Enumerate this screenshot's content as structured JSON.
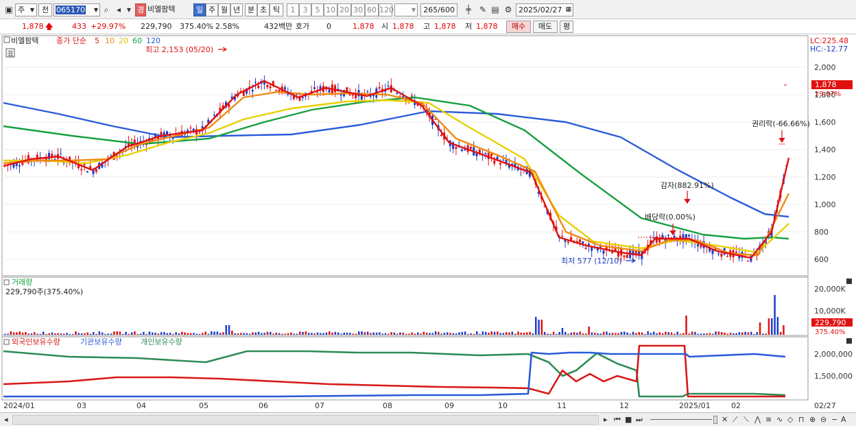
{
  "toolbar": {
    "market_select": "주",
    "prev_label": "전",
    "code_value": "065170",
    "stock_tag": "경",
    "stock_name": "비엘팜텍",
    "periods": [
      "일",
      "주",
      "월",
      "년",
      "분",
      "초",
      "틱"
    ],
    "active_period": "일",
    "intervals": [
      "1",
      "3",
      "5",
      "10",
      "20",
      "30",
      "60",
      "120"
    ],
    "count": "265",
    "count_max": "/600",
    "date": "2025/02/27"
  },
  "quote": {
    "price": "1,878",
    "change": "433",
    "change_pct": "+29.97%",
    "volume": "229,790",
    "volume_ratio": "375.40%",
    "turnover_pct": "2.58%",
    "trade_value": "432백만",
    "hoga_label": "호가",
    "hoga_value": "0",
    "last": "1,878",
    "open_label": "시",
    "open": "1,878",
    "high_label": "고",
    "high": "1,878",
    "low_label": "저",
    "low": "1,878",
    "buy_label": "매수",
    "sell_label": "매도",
    "avg_label": "평"
  },
  "price_panel": {
    "name": "비엘팜텍",
    "ma_title": "종가 단순",
    "ma_periods": [
      "5",
      "10",
      "20",
      "60",
      "120"
    ],
    "ma_colors": [
      "#e01010",
      "#f08a10",
      "#e8d000",
      "#17a040",
      "#2a5bd8"
    ],
    "lc": "LC:225.48",
    "hc": "HC:-12.77",
    "current_tag": "1,878",
    "current_pct": "29.97%",
    "high_note": "최고 2,153 (05/20)",
    "low_note": "최저 577 (12/10)",
    "event_gamja": "감자(882.91%)",
    "event_dividend": "배당락(0.00%)",
    "event_rights": "권리락(-66.66%)",
    "y_ticks": [
      "2,000",
      "1,800",
      "1,600",
      "1,400",
      "1,200",
      "1,000",
      "800",
      "600"
    ]
  },
  "volume_panel": {
    "title": "거래량",
    "info": "229,790주(375.40%)",
    "y_ticks": [
      "20,000K",
      "10,000K"
    ],
    "current_tag": "229,790",
    "current_pct": "375.40%"
  },
  "holdings_panel": {
    "legend": [
      "외국인보유수량",
      "기관보유수량",
      "개인보유수량"
    ],
    "legend_colors": [
      "#d81818",
      "#2a5bd8",
      "#2e8b57"
    ],
    "y_ticks": [
      "2,000,000",
      "1,500,000"
    ]
  },
  "x_axis": {
    "labels": [
      "2024/01",
      "03",
      "04",
      "05",
      "06",
      "07",
      "08",
      "09",
      "10",
      "11",
      "12",
      "2025/01",
      "02"
    ],
    "end_label": "02/27"
  },
  "chart_data": {
    "type": "candlestick-with-indicators",
    "ma_series": [
      {
        "name": "5",
        "points": [
          [
            0,
            1280
          ],
          [
            40,
            1330
          ],
          [
            80,
            1350
          ],
          [
            130,
            1250
          ],
          [
            180,
            1420
          ],
          [
            230,
            1500
          ],
          [
            290,
            1540
          ],
          [
            340,
            1800
          ],
          [
            380,
            1900
          ],
          [
            430,
            1780
          ],
          [
            470,
            1850
          ],
          [
            530,
            1790
          ],
          [
            565,
            1850
          ],
          [
            610,
            1720
          ],
          [
            650,
            1450
          ],
          [
            700,
            1360
          ],
          [
            770,
            1230
          ],
          [
            810,
            760
          ],
          [
            850,
            700
          ],
          [
            900,
            650
          ],
          [
            930,
            630
          ],
          [
            950,
            750
          ],
          [
            1000,
            750
          ],
          [
            1040,
            660
          ],
          [
            1090,
            610
          ],
          [
            1120,
            800
          ],
          [
            1145,
            1340
          ]
        ]
      },
      {
        "name": "10",
        "points": [
          [
            0,
            1300
          ],
          [
            50,
            1320
          ],
          [
            100,
            1320
          ],
          [
            150,
            1330
          ],
          [
            200,
            1440
          ],
          [
            250,
            1500
          ],
          [
            300,
            1560
          ],
          [
            350,
            1780
          ],
          [
            400,
            1820
          ],
          [
            450,
            1800
          ],
          [
            500,
            1810
          ],
          [
            560,
            1800
          ],
          [
            610,
            1740
          ],
          [
            660,
            1480
          ],
          [
            720,
            1360
          ],
          [
            775,
            1240
          ],
          [
            820,
            800
          ],
          [
            870,
            700
          ],
          [
            930,
            660
          ],
          [
            970,
            740
          ],
          [
            1010,
            740
          ],
          [
            1060,
            640
          ],
          [
            1100,
            630
          ],
          [
            1145,
            1080
          ]
        ]
      },
      {
        "name": "20",
        "points": [
          [
            0,
            1320
          ],
          [
            60,
            1320
          ],
          [
            120,
            1300
          ],
          [
            180,
            1360
          ],
          [
            240,
            1450
          ],
          [
            300,
            1520
          ],
          [
            350,
            1620
          ],
          [
            420,
            1700
          ],
          [
            500,
            1750
          ],
          [
            560,
            1760
          ],
          [
            620,
            1740
          ],
          [
            680,
            1560
          ],
          [
            760,
            1330
          ],
          [
            810,
            920
          ],
          [
            860,
            730
          ],
          [
            930,
            680
          ],
          [
            980,
            740
          ],
          [
            1040,
            700
          ],
          [
            1100,
            650
          ],
          [
            1145,
            860
          ]
        ]
      },
      {
        "name": "60",
        "points": [
          [
            0,
            1570
          ],
          [
            100,
            1500
          ],
          [
            200,
            1440
          ],
          [
            300,
            1480
          ],
          [
            380,
            1600
          ],
          [
            450,
            1690
          ],
          [
            530,
            1750
          ],
          [
            600,
            1780
          ],
          [
            680,
            1720
          ],
          [
            760,
            1540
          ],
          [
            840,
            1230
          ],
          [
            930,
            900
          ],
          [
            1020,
            780
          ],
          [
            1080,
            750
          ],
          [
            1120,
            760
          ],
          [
            1145,
            750
          ]
        ]
      },
      {
        "name": "120",
        "points": [
          [
            0,
            1740
          ],
          [
            80,
            1660
          ],
          [
            160,
            1570
          ],
          [
            240,
            1490
          ],
          [
            320,
            1500
          ],
          [
            420,
            1510
          ],
          [
            520,
            1580
          ],
          [
            620,
            1680
          ],
          [
            720,
            1660
          ],
          [
            820,
            1600
          ],
          [
            900,
            1490
          ],
          [
            980,
            1260
          ],
          [
            1060,
            1050
          ],
          [
            1110,
            930
          ],
          [
            1145,
            910
          ]
        ]
      }
    ],
    "price_range": [
      500,
      2250
    ],
    "price_reference": [
      {
        "price": 2000,
        "y": 98
      },
      {
        "price": 600,
        "y": 378
      }
    ]
  }
}
